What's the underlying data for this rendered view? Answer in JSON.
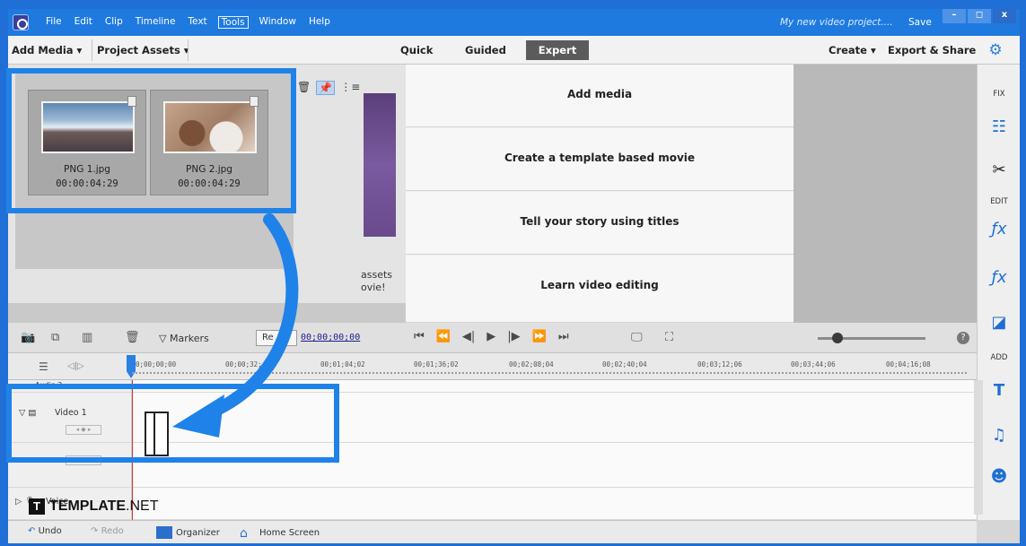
{
  "titlebar": {
    "menu": [
      "File",
      "Edit",
      "Clip",
      "Timeline",
      "Text",
      "Tools",
      "Window",
      "Help"
    ],
    "active_menu_index": 5,
    "project_name": "My new video project....",
    "save_label": "Save",
    "controls": [
      "–",
      "◻",
      "x"
    ]
  },
  "toolbar": {
    "add_media": "Add Media ▾",
    "project_assets": "Project Assets ▾",
    "quick": "Quick",
    "guided": "Guided",
    "expert": "Expert",
    "create": "Create ▾",
    "export_share": "Export & Share"
  },
  "assets": [
    {
      "name": "PNG 1.jpg",
      "duration": "00:00:04:29"
    },
    {
      "name": "PNG 2.jpg",
      "duration": "00:00:04:29"
    }
  ],
  "assets_caption": [
    "assets",
    "ovie!"
  ],
  "guide": {
    "items": [
      "Add media",
      "Create a template based movie",
      "Tell your story using titles",
      "Learn video editing"
    ]
  },
  "side_tools": {
    "fix_label": "FIX",
    "edit_label": "EDIT",
    "add_label": "ADD"
  },
  "timeline": {
    "markers_label": "Markers",
    "render_label": "Re",
    "timecode": "00;00;00;00",
    "ticks": [
      "0;00;00;00",
      "00;00;32;",
      "00;01;04;02",
      "00;01;36;02",
      "00;02;08;04",
      "00;02;40;04",
      "00;03;12;06",
      "00;03;44;06",
      "00;04;16;08"
    ],
    "tracks": {
      "audio2": "Audio 2",
      "video1": "Video 1",
      "voice": "Voice"
    }
  },
  "statusbar": {
    "undo": "Undo",
    "redo": "Redo",
    "organizer": "Organizer",
    "home": "Home Screen"
  },
  "watermark": {
    "brand": "TEMPLATE",
    "suffix": ".NET"
  },
  "colors": {
    "accent": "#1f82e8",
    "titlebar": "#1f7ae0"
  }
}
